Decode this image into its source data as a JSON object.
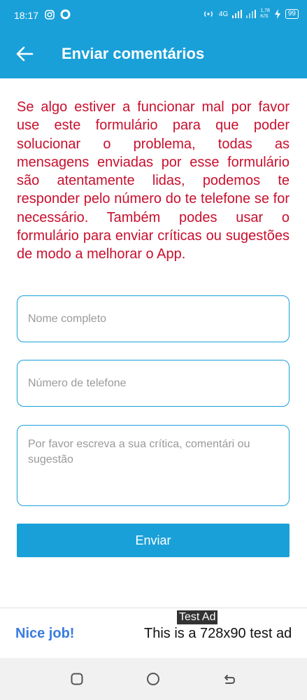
{
  "status_bar": {
    "time": "18:17",
    "network": "4G",
    "speed_top": "1,78",
    "speed_bottom": "K/S",
    "battery": "99"
  },
  "header": {
    "title": "Enviar comentários",
    "back_icon": "arrow-left-icon"
  },
  "intro_text": "Se algo estiver a funcionar mal por favor use este formulário para que poder solucionar o problema, todas as mensagens enviadas por esse formulário são atentamente lidas, podemos te responder pelo número do te telefone se for necessário. Também podes usar o formulário para enviar críticas ou sugestões de modo a melhorar o App.",
  "form": {
    "name_placeholder": "Nome completo",
    "phone_placeholder": "Número de telefone",
    "message_placeholder": "Por favor escreva a sua crítica, comentári ou sugestão",
    "submit_label": "Enviar"
  },
  "ad": {
    "badge": "Test Ad",
    "headline": "Nice job!",
    "text": "This is a 728x90 test ad"
  },
  "colors": {
    "primary": "#1aa0d8",
    "intro_text": "#c8102e"
  }
}
